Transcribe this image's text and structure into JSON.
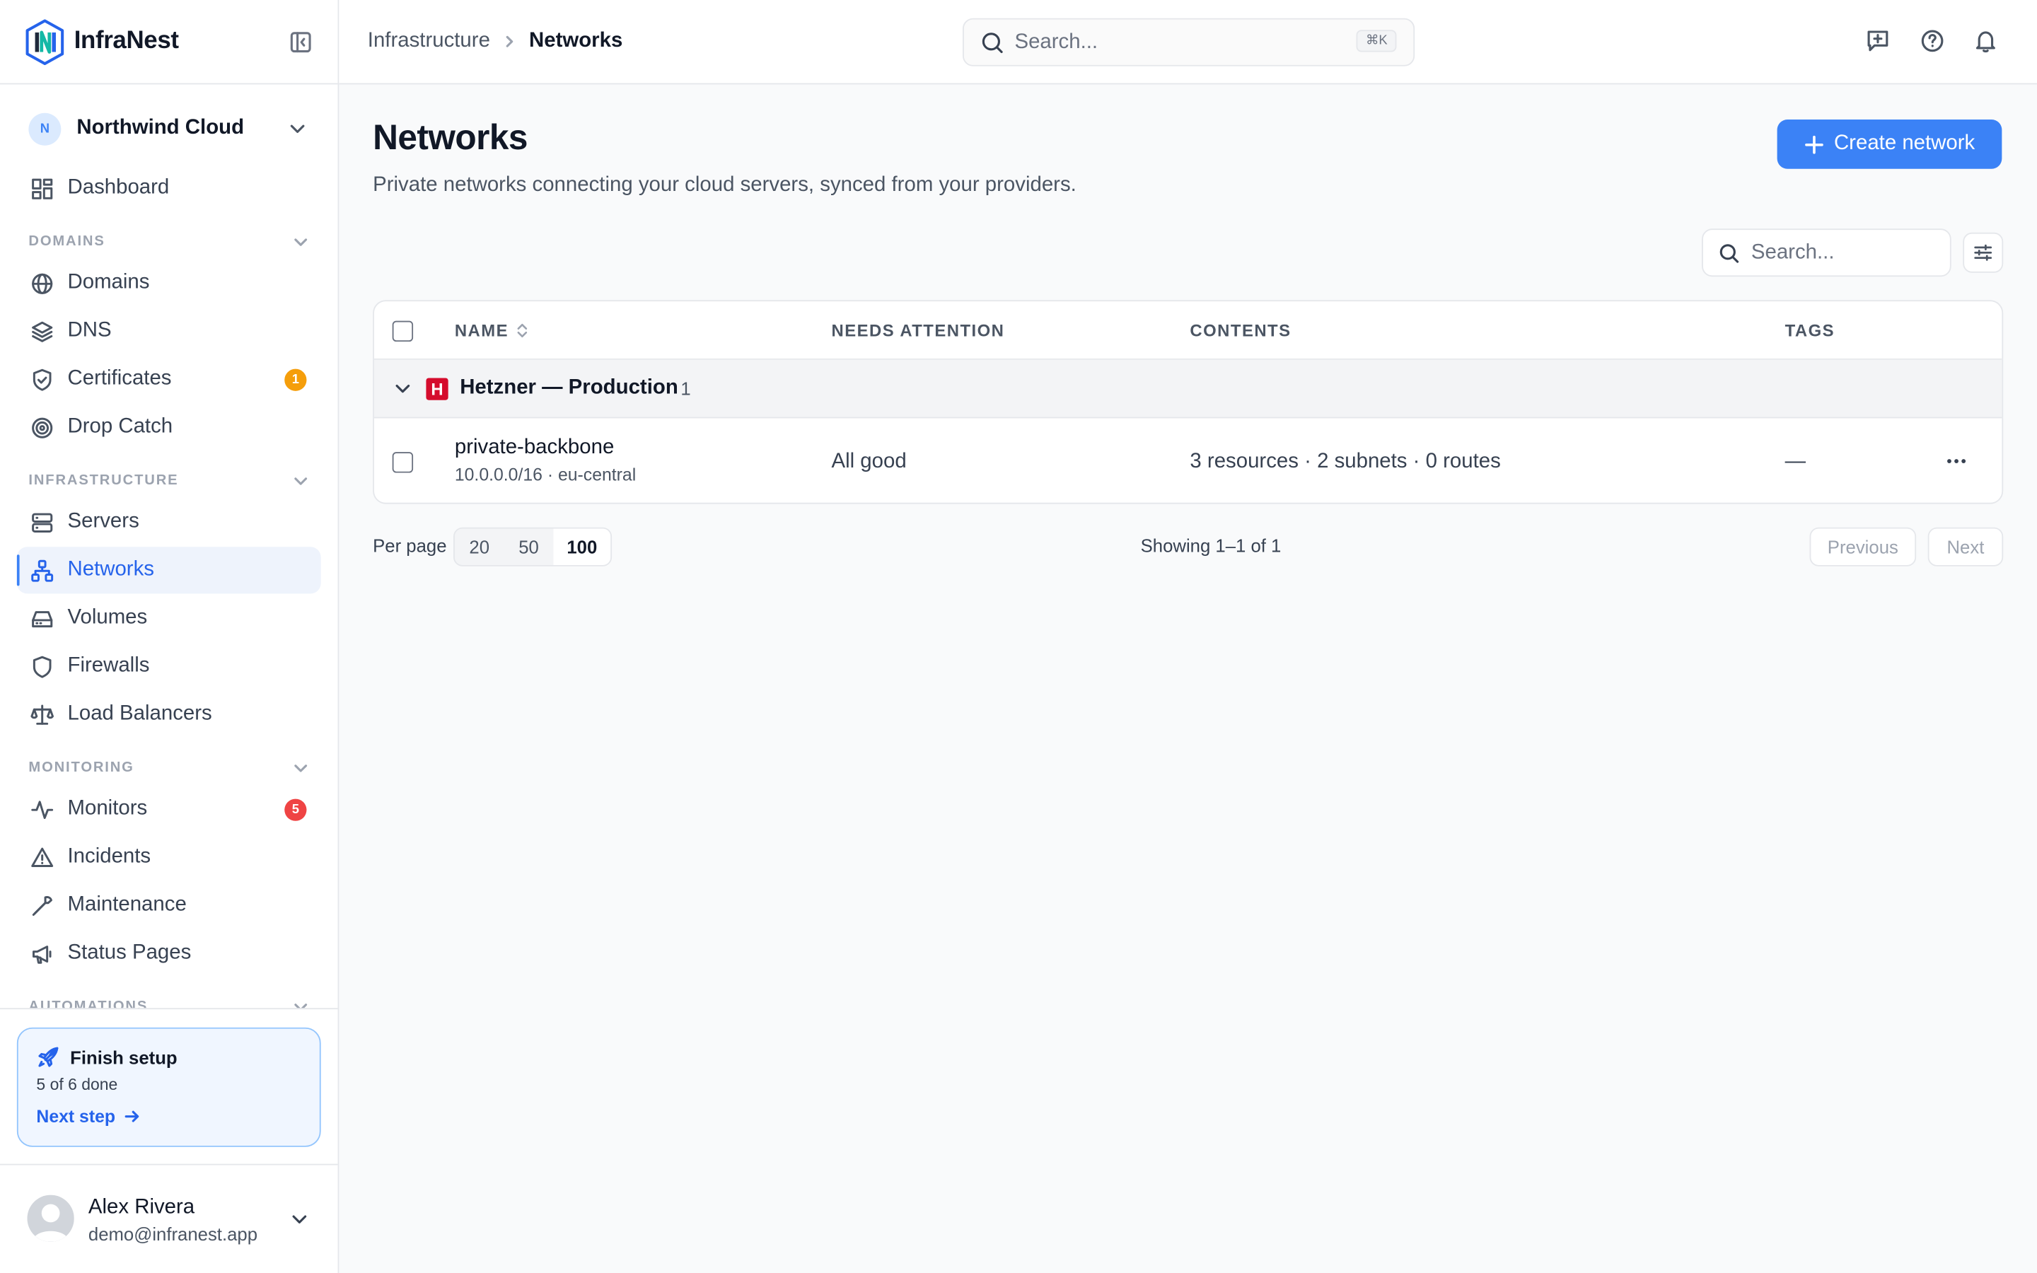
{
  "brand": {
    "name": "InfraNest"
  },
  "org": {
    "initial": "N",
    "name": "Northwind Cloud"
  },
  "sidebar": {
    "dashboard": "Dashboard",
    "sections": {
      "domains": "DOMAINS",
      "infrastructure": "INFRASTRUCTURE",
      "monitoring": "MONITORING",
      "automations": "AUTOMATIONS"
    },
    "items": {
      "domains": "Domains",
      "dns": "DNS",
      "certificates": "Certificates",
      "drop_catch": "Drop Catch",
      "servers": "Servers",
      "networks": "Networks",
      "volumes": "Volumes",
      "firewalls": "Firewalls",
      "load_balancers": "Load Balancers",
      "monitors": "Monitors",
      "incidents": "Incidents",
      "maintenance": "Maintenance",
      "status_pages": "Status Pages"
    },
    "badges": {
      "certificates": "1",
      "monitors": "5"
    },
    "badge_colors": {
      "certificates": "#f59e0b",
      "monitors": "#ef4444"
    }
  },
  "setup": {
    "title": "Finish setup",
    "progress": "5 of 6 done",
    "next_step": "Next step"
  },
  "user": {
    "name": "Alex Rivera",
    "email": "demo@infranest.app"
  },
  "topbar": {
    "breadcrumb": [
      "Infrastructure",
      "Networks"
    ],
    "search_placeholder": "Search...",
    "shortcut": "⌘K",
    "icons": [
      "feedback-icon",
      "help-icon",
      "bell-icon"
    ]
  },
  "page": {
    "title": "Networks",
    "subtitle": "Private networks connecting your cloud servers, synced from your providers.",
    "create_label": "Create network",
    "table_search_placeholder": "Search..."
  },
  "table": {
    "columns": [
      "NAME",
      "NEEDS ATTENTION",
      "CONTENTS",
      "TAGS"
    ],
    "groups": [
      {
        "provider_initial": "H",
        "name": "Hetzner — Production",
        "count": "1",
        "rows": [
          {
            "name": "private-backbone",
            "meta": "10.0.0.0/16 · eu-central",
            "attention": "All good",
            "contents": "3 resources · 2 subnets · 0 routes",
            "tags": "—"
          }
        ]
      }
    ]
  },
  "pagination": {
    "per_page_label": "Per page",
    "options": [
      "20",
      "50",
      "100"
    ],
    "selected": "100",
    "showing": "Showing 1–1 of 1",
    "previous": "Previous",
    "next": "Next"
  },
  "colors": {
    "accent": "#3b82f6",
    "hetzner": "#d50c2d"
  }
}
